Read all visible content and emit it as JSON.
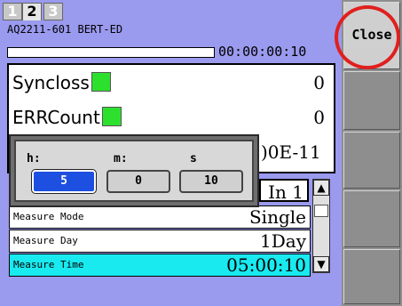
{
  "tabs": [
    {
      "label": "1"
    },
    {
      "label": "2"
    },
    {
      "label": "3"
    }
  ],
  "device_title": "AQ2211-601 BERT-ED",
  "elapsed_time": "00:00:00:10",
  "progress_fraction": 0.0,
  "status": {
    "sync_label": "Syncloss",
    "sync_value": "0",
    "err_label": "ERRCount",
    "err_value": "0",
    "err_rate_partial": ")0E-11",
    "indicator_color": "#2ee02e"
  },
  "time_popup": {
    "h_label": "h:",
    "m_label": "m:",
    "s_label": "s",
    "h_value": "5",
    "m_value": "0",
    "s_value": "10"
  },
  "input_select": "In 1",
  "settings": [
    {
      "key": "Measure Mode",
      "value": "Single"
    },
    {
      "key": "Measure Day",
      "value": "1Day"
    },
    {
      "key": "Measure Time",
      "value": "05:00:10"
    }
  ],
  "side": {
    "close_label": "Close"
  },
  "colors": {
    "selected_row": "#18eaf0",
    "selected_field": "#1d4fe0",
    "highlight_ring": "#e0201e"
  }
}
